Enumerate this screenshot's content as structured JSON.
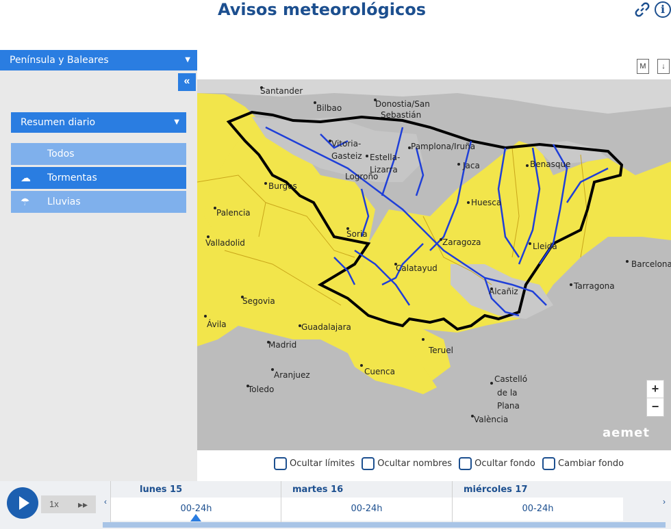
{
  "header": {
    "title": "Avisos meteorológicos",
    "link_icon": "link-icon",
    "info_icon": "info-icon",
    "info_glyph": "i"
  },
  "region_select": {
    "value": "Península y Baleares"
  },
  "sidebar": {
    "collapse_label": "«",
    "daily_select": {
      "value": "Resumen diario"
    },
    "filters": [
      {
        "label": "Todos",
        "icon": "",
        "active": false
      },
      {
        "label": "Tormentas",
        "icon": "storm-icon",
        "active": true
      },
      {
        "label": "Lluvias",
        "icon": "rain-icon",
        "active": false
      }
    ]
  },
  "map_tools": {
    "m_label": "M",
    "download_label": "↓"
  },
  "map": {
    "places": [
      "Santander",
      "Bilbao",
      "Donostia/San",
      "Sebastián",
      "Vitoria-",
      "Gasteiz",
      "Pamplona/Iruña",
      "Estella-",
      "Lizarra",
      "Logroño",
      "Jaca",
      "Benasque",
      "Burgos",
      "Huesca",
      "Palencia",
      "Soria",
      "Zaragoza",
      "Lleida",
      "Valladolid",
      "Barcelona",
      "Calatayud",
      "Tarragona",
      "Alcañiz",
      "Segovia",
      "Ávila",
      "Guadalajara",
      "Madrid",
      "Teruel",
      "Aranjuez",
      "Cuenca",
      "Toledo",
      "Castelló",
      "de la",
      "Plana",
      "València"
    ],
    "logo_text": "aemet",
    "zoom_in": "+",
    "zoom_out": "−",
    "colors": {
      "warning_yellow": "#f5e94c",
      "no_warning": "#c8c8c8",
      "rivers": "#1f3fd8",
      "boundary": "#000000"
    }
  },
  "map_options": [
    {
      "label": "Ocultar límites"
    },
    {
      "label": "Ocultar nombres"
    },
    {
      "label": "Ocultar fondo"
    },
    {
      "label": "Cambiar fondo"
    }
  ],
  "timeline": {
    "speed": "1x",
    "fast_forward": "▸▸",
    "prev": "‹",
    "next": "›",
    "days": [
      {
        "day": "lunes 15",
        "range": "00-24h"
      },
      {
        "day": "martes 16",
        "range": "00-24h"
      },
      {
        "day": "miércoles 17",
        "range": "00-24h"
      }
    ]
  }
}
